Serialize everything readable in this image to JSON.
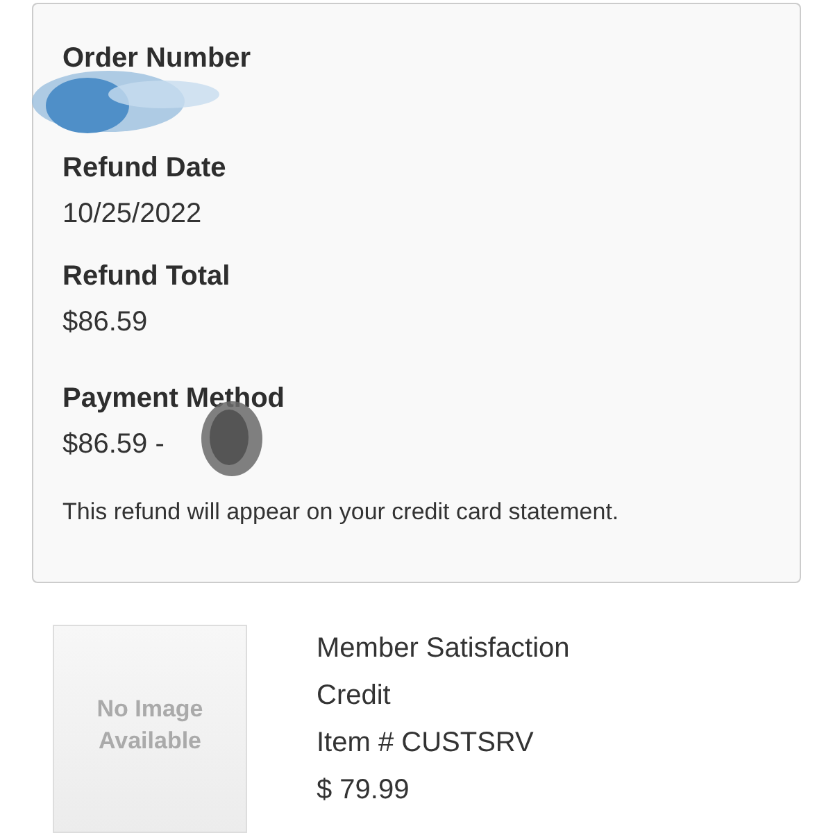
{
  "refund": {
    "sections": [
      {
        "label": "Order Number",
        "kind": "redacted",
        "color": "#4f8fc8"
      },
      {
        "label": "Refund Date",
        "value": "10/25/2022",
        "kind": "plain"
      },
      {
        "label": "Refund Total",
        "value": "$86.59",
        "kind": "plain"
      },
      {
        "label": "Payment Method",
        "value": "$86.59 -",
        "kind": "redacted",
        "color": "#555555"
      }
    ],
    "note": "This refund will appear on your credit card statement."
  },
  "item": {
    "image_text": [
      "No Image",
      "Available"
    ],
    "name_lines": [
      "Member Satisfaction",
      "Credit"
    ],
    "item_number": "Item # CUSTSRV",
    "price": "$ 79.99"
  }
}
